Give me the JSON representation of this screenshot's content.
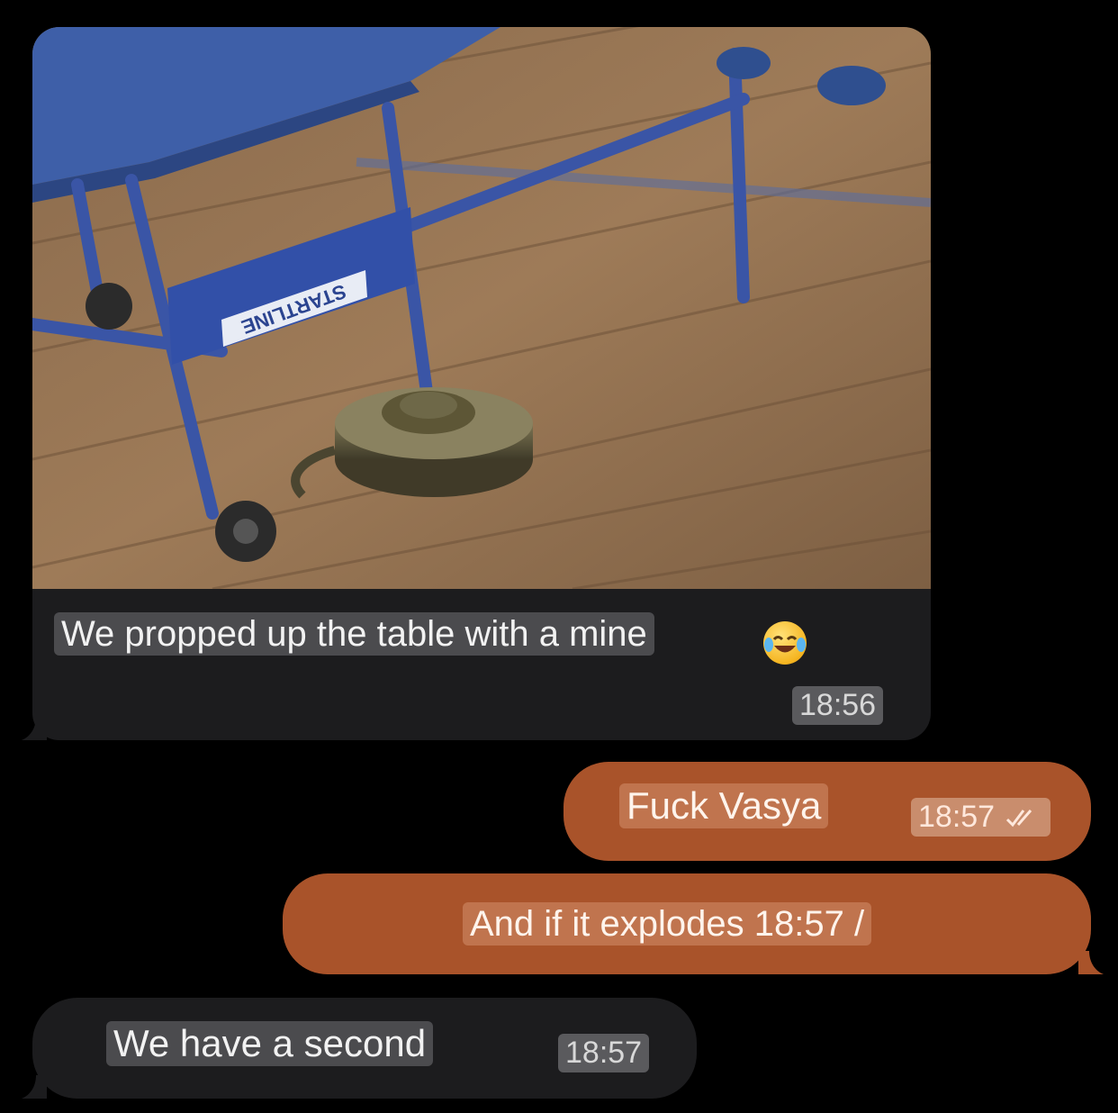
{
  "messages": [
    {
      "id": "photo",
      "direction": "incoming",
      "image": "ping-pong-table-propped-on-mine-photo",
      "image_text": "STARTLINE",
      "text": "We propped up the table with a mine",
      "emoji": "face-with-tears-of-joy-icon",
      "time": "18:56"
    },
    {
      "id": "vasya",
      "direction": "outgoing",
      "text": "Fuck Vasya",
      "time": "18:57",
      "status_icon": "double-check-icon"
    },
    {
      "id": "explodes",
      "direction": "outgoing",
      "text": "And if it explodes 18:57 /"
    },
    {
      "id": "second",
      "direction": "incoming",
      "text": "We have a second",
      "time": "18:57"
    }
  ],
  "colors": {
    "background": "#000000",
    "incoming_bubble": "#1c1c1e",
    "outgoing_bubble": "#a9532a"
  }
}
